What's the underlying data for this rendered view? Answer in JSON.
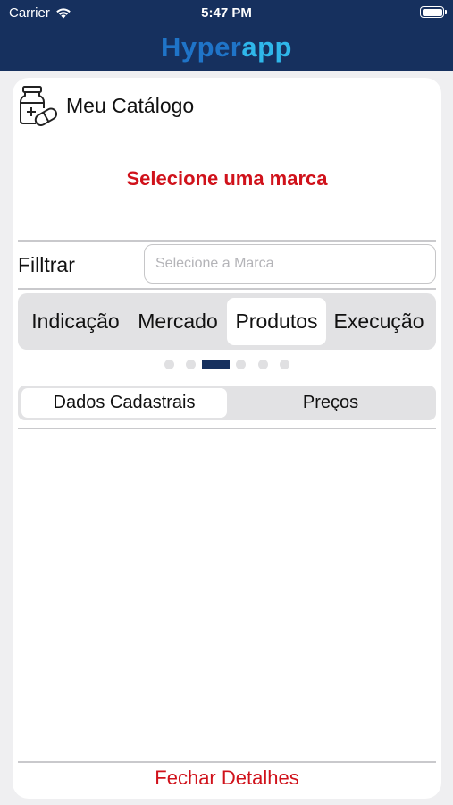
{
  "status_bar": {
    "carrier": "Carrier",
    "time": "5:47 PM"
  },
  "header": {
    "logo_part1": "Hyper",
    "logo_part2": "app"
  },
  "catalog": {
    "title": "Meu Catálogo",
    "icon": "medicine-bottle-pill-icon"
  },
  "prompt": "Selecione uma marca",
  "filter": {
    "label": "Filltrar",
    "placeholder": "Selecione a Marca",
    "value": ""
  },
  "tabs": [
    {
      "label": "Indicação",
      "active": false
    },
    {
      "label": "Mercado",
      "active": false
    },
    {
      "label": "Produtos",
      "active": true
    },
    {
      "label": "Execução",
      "active": false
    }
  ],
  "page_indicator": {
    "count": 6,
    "active_index": 2
  },
  "segments": [
    {
      "label": "Dados Cadastrais",
      "active": true
    },
    {
      "label": "Preços",
      "active": false
    }
  ],
  "footer": {
    "close_label": "Fechar Detalhes"
  },
  "colors": {
    "header_bg": "#16305e",
    "accent_red": "#d0121b",
    "logo_dark": "#1f74c8",
    "logo_light": "#2fb7ea"
  }
}
